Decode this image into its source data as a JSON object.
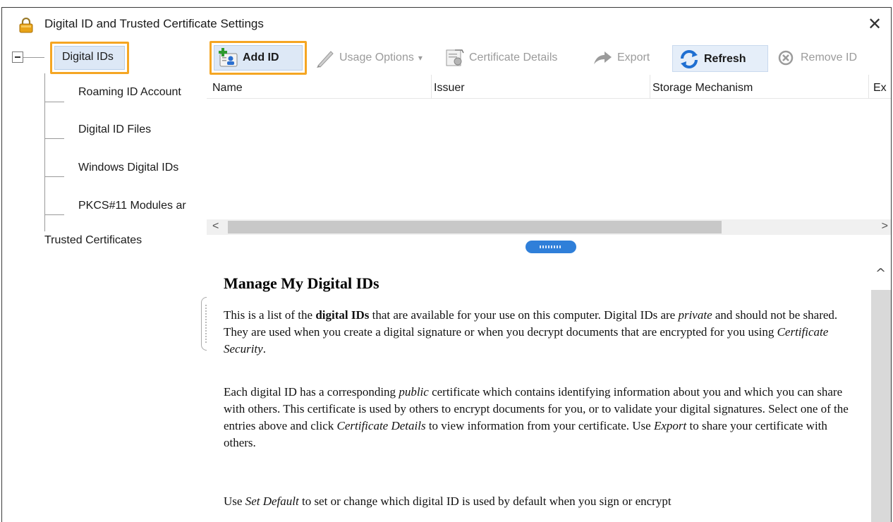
{
  "window": {
    "title": "Digital ID and Trusted Certificate Settings",
    "close_glyph": "✕"
  },
  "tree": {
    "root_label": "Digital IDs",
    "children": [
      "Roaming ID Account",
      "Digital ID Files",
      "Windows Digital IDs",
      "PKCS#11 Modules ar"
    ],
    "trusted_label": "Trusted Certificates"
  },
  "toolbar": {
    "add_id": "Add ID",
    "usage_options": "Usage Options",
    "usage_options_arrow": "▾",
    "certificate_details": "Certificate Details",
    "export": "Export",
    "refresh": "Refresh",
    "remove_id": "Remove ID"
  },
  "table": {
    "columns": [
      "Name",
      "Issuer",
      "Storage Mechanism",
      "Ex"
    ],
    "scroll_left": "<",
    "scroll_right": ">"
  },
  "content": {
    "heading": "Manage My Digital IDs",
    "p1_segments": [
      {
        "t": "This is a list of the ",
        "s": "n"
      },
      {
        "t": "digital IDs",
        "s": "b"
      },
      {
        "t": " that are available for your use on this computer. Digital IDs are ",
        "s": "n"
      },
      {
        "t": "private",
        "s": "i"
      },
      {
        "t": " and should not be shared. They are used when you create a digital signature or when you decrypt documents that are encrypted for you using ",
        "s": "n"
      },
      {
        "t": "Certificate Security",
        "s": "i"
      },
      {
        "t": ".",
        "s": "n"
      }
    ],
    "p2_segments": [
      {
        "t": "Each digital ID has a corresponding ",
        "s": "n"
      },
      {
        "t": "public",
        "s": "i"
      },
      {
        "t": " certificate which contains identifying information about you and which you can share with others. This certificate is used by others to encrypt documents for you, or to validate your digital signatures. Select one of the entries above and click ",
        "s": "n"
      },
      {
        "t": "Certificate Details",
        "s": "i"
      },
      {
        "t": " to view information from your certificate. Use ",
        "s": "n"
      },
      {
        "t": "Export",
        "s": "i"
      },
      {
        "t": " to share your certificate with others.",
        "s": "n"
      }
    ],
    "p3_segments": [
      {
        "t": "Use ",
        "s": "n"
      },
      {
        "t": "Set Default",
        "s": "i"
      },
      {
        "t": " to set or change which digital ID is used by default when you sign or encrypt",
        "s": "n"
      }
    ]
  },
  "vscroll": {
    "up_glyph": "^"
  },
  "colors": {
    "highlight": "#f5a623",
    "selection": "#dde8f6",
    "grip": "#2f7fd9"
  }
}
